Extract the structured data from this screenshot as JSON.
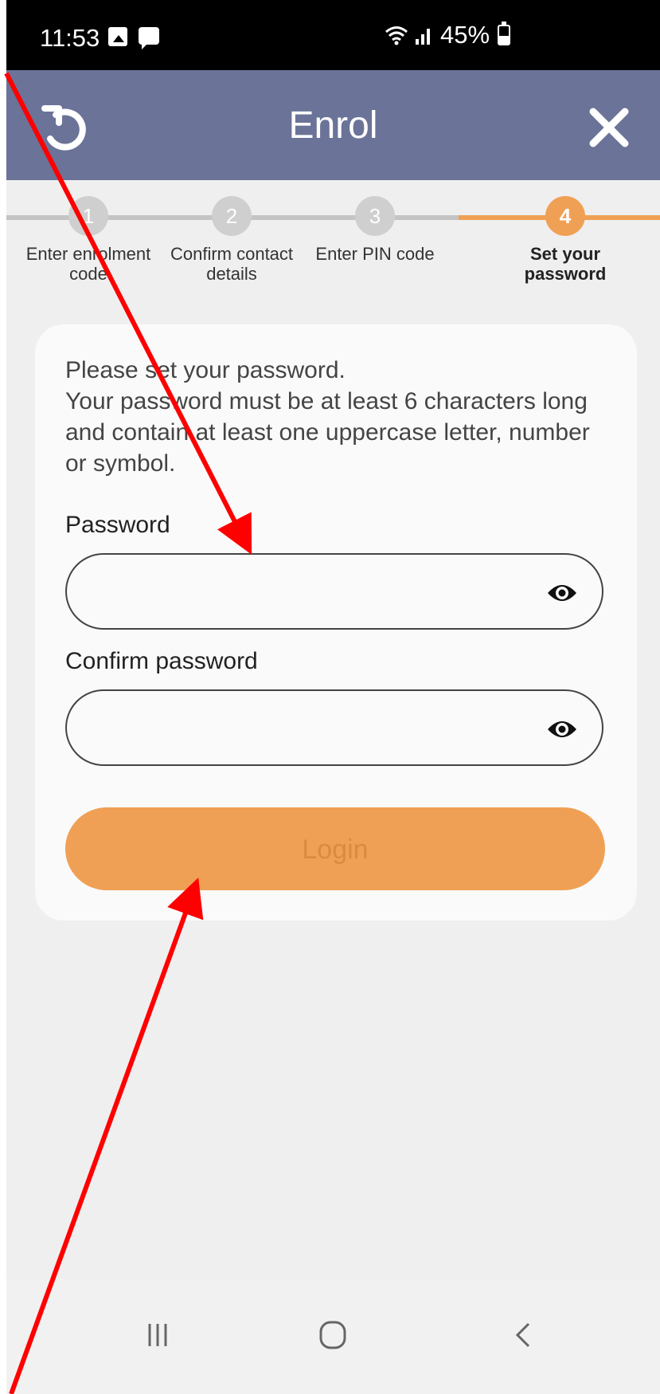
{
  "status_bar": {
    "time": "11:53",
    "battery_percent": "45%"
  },
  "header": {
    "title": "Enrol",
    "reset_icon": "reset-icon",
    "close_icon": "close-icon"
  },
  "stepper": {
    "current_step": 4,
    "steps": [
      {
        "number": "1",
        "label": "Enter enrolment code"
      },
      {
        "number": "2",
        "label": "Confirm contact details"
      },
      {
        "number": "3",
        "label": "Enter PIN code"
      },
      {
        "number": "4",
        "label": "Set your password"
      }
    ]
  },
  "form": {
    "instructions": "Please set your password.\nYour password must be at least 6 characters long and contain at least one uppercase letter, number or symbol.",
    "password_label": "Password",
    "password_value": "",
    "confirm_label": "Confirm password",
    "confirm_value": "",
    "login_label": "Login"
  },
  "colors": {
    "header_bg": "#6b7398",
    "accent": "#f0a054",
    "annotation": "#ff0000"
  }
}
